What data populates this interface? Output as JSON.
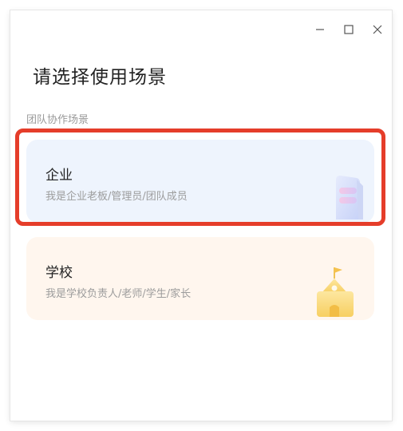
{
  "window": {
    "controls": {
      "minimize": "minimize-icon",
      "maximize": "maximize-icon",
      "close": "close-icon"
    }
  },
  "title": "请选择使用场景",
  "section_label": "团队协作场景",
  "cards": [
    {
      "title": "企业",
      "subtitle": "我是企业老板/管理员/团队成员",
      "icon": "building-icon",
      "bg_color": "#eef4fd"
    },
    {
      "title": "学校",
      "subtitle": "我是学校负责人/老师/学生/家长",
      "icon": "school-icon",
      "bg_color": "#fff6ee"
    }
  ],
  "colors": {
    "highlight_border": "#e53d2a"
  }
}
